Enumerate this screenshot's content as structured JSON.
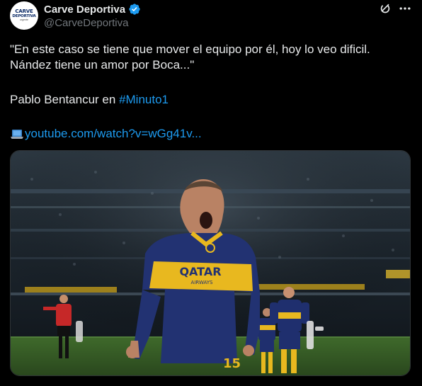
{
  "author": {
    "display_name": "Carve Deportiva",
    "handle": "@CarveDeportiva",
    "avatar_text": [
      "CARVE",
      "DEPORTIVA",
      "urgente"
    ],
    "verified": true
  },
  "tweet": {
    "line1": "\"En este caso se tiene que mover el equipo por él, hoy lo veo dificil.",
    "line2": "Nández tiene un amor por Boca...\"",
    "line3_prefix": "Pablo Bentancur en ",
    "hashtag": "#Minuto1",
    "link_text": "youtube.com/watch?v=wGg41v..."
  },
  "photo": {
    "sponsor": "QATAR",
    "sponsor_sub": "AIRWAYS",
    "shirt_number": "15"
  },
  "icons": {
    "verified": "verified-badge-icon",
    "grok": "grok-icon",
    "more": "more-dots-icon",
    "link": "laptop-icon"
  },
  "colors": {
    "background": "#000000",
    "text": "#e7e9ea",
    "secondary": "#71767b",
    "accent": "#1d9bf0"
  }
}
